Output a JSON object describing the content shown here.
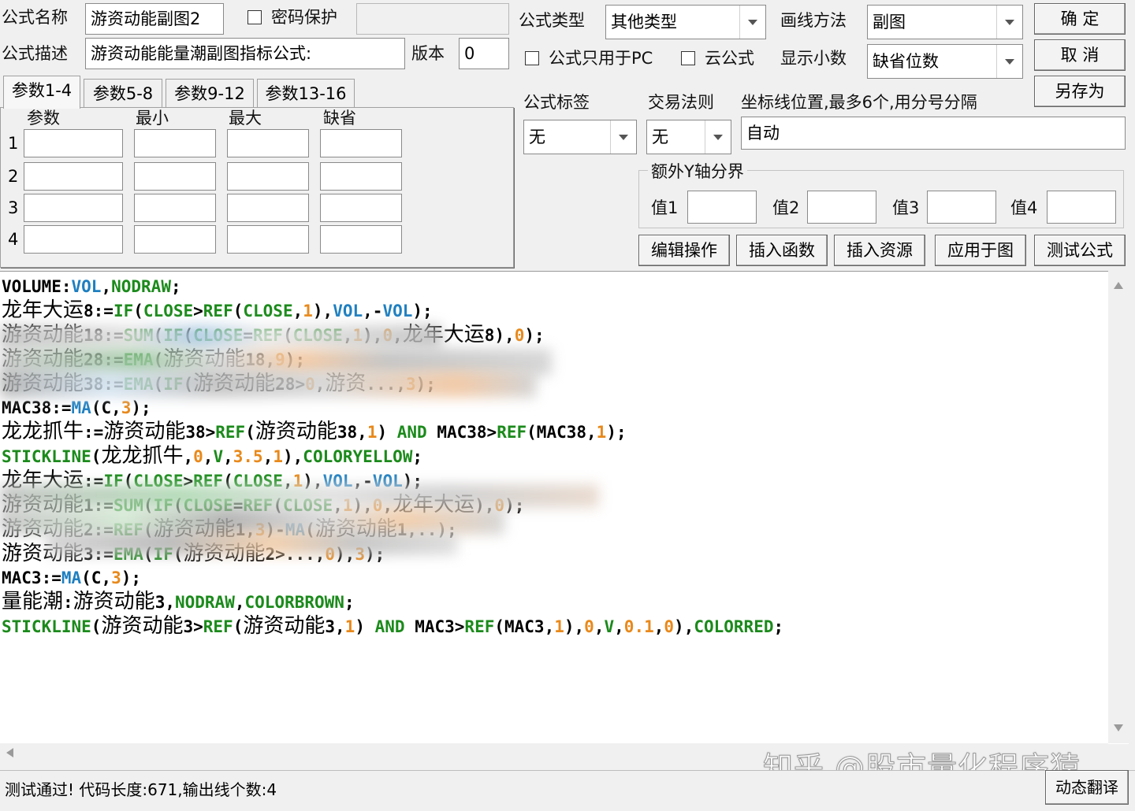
{
  "form": {
    "name_label": "公式名称",
    "name_value": "游资动能副图2",
    "password_label": "密码保护",
    "desc_label": "公式描述",
    "desc_value": "游资动能能量潮副图指标公式:",
    "version_label": "版本",
    "version_value": "0",
    "type_label": "公式类型",
    "type_value": "其他类型",
    "draw_label": "画线方法",
    "draw_value": "副图",
    "pc_only_label": "公式只用于PC",
    "cloud_label": "云公式",
    "decimal_label": "显示小数",
    "decimal_value": "缺省位数",
    "tag_label": "公式标签",
    "tag_value": "无",
    "trade_label": "交易法则",
    "trade_value": "无",
    "coord_label": "坐标线位置,最多6个,用分号分隔",
    "coord_value": "自动"
  },
  "buttons": {
    "ok": "确  定",
    "cancel": "取  消",
    "save_as": "另存为",
    "edit_ops": "编辑操作",
    "insert_func": "插入函数",
    "insert_res": "插入资源",
    "apply_chart": "应用于图",
    "test": "测试公式",
    "dynamic_translate": "动态翻译"
  },
  "tabs": [
    "参数1-4",
    "参数5-8",
    "参数9-12",
    "参数13-16"
  ],
  "params": {
    "headers": [
      "参数",
      "最小",
      "最大",
      "缺省"
    ],
    "rows": [
      "1",
      "2",
      "3",
      "4"
    ]
  },
  "y_axis": {
    "title": "额外Y轴分界",
    "labels": [
      "值1",
      "值2",
      "值3",
      "值4"
    ]
  },
  "status": "测试通过! 代码长度:671,输出线个数:4",
  "watermark": "知乎 @股市量化程序猿",
  "colors": {
    "keyword_green": "#1b8a1b",
    "keyword_blue": "#1e7fc0",
    "number_orange": "#e8891b"
  }
}
